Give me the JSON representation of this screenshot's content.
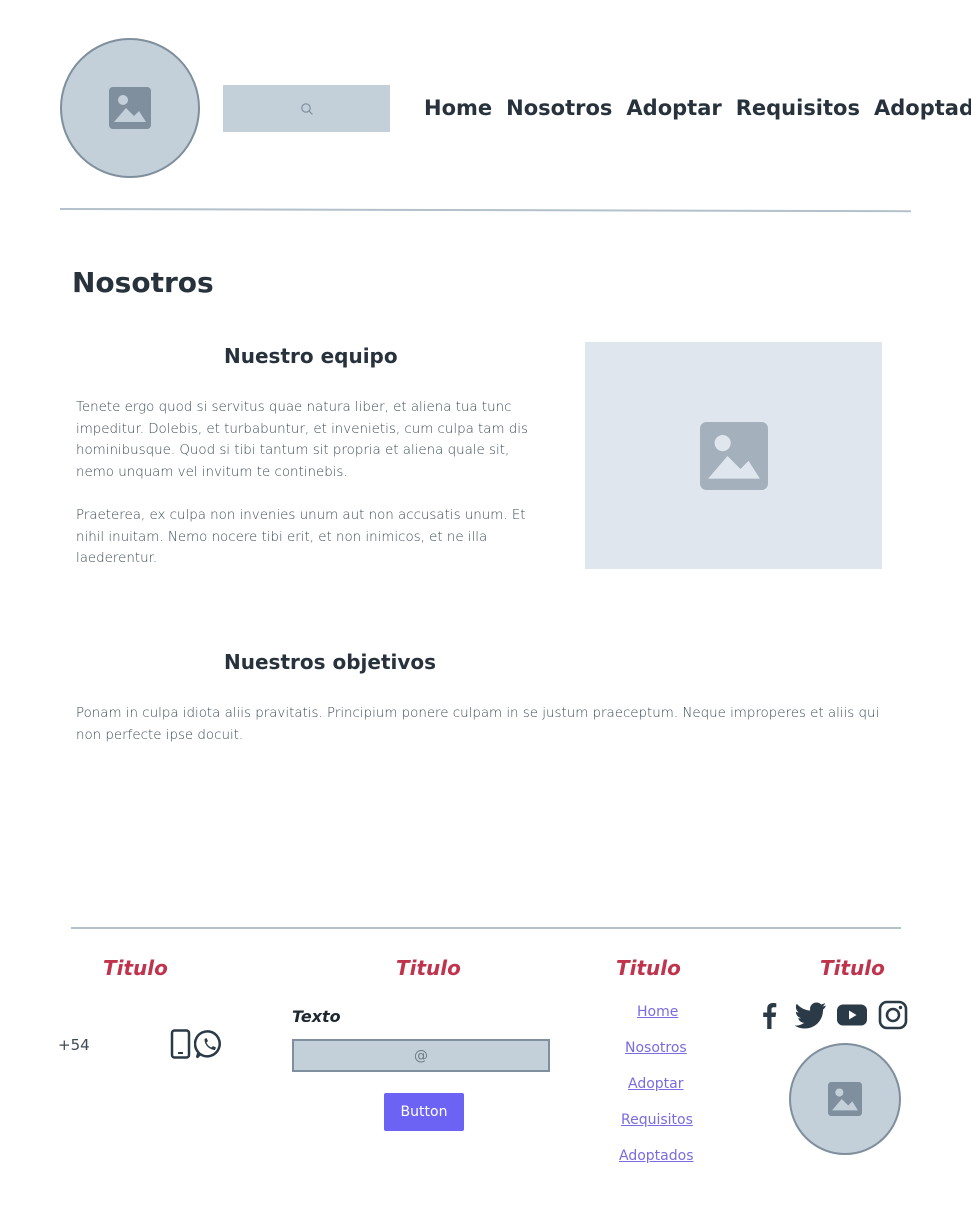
{
  "header": {
    "nav": [
      "Home",
      "Nosotros",
      "Adoptar",
      "Requisitos",
      "Adoptados"
    ],
    "search_icon": "search-icon",
    "logo_icon": "image-placeholder-icon"
  },
  "main": {
    "title": "Nosotros",
    "team": {
      "title": "Nuestro equipo",
      "paragraph1": "Tenete ergo quod si servitus quae natura liber, et aliena tua tunc impeditur. Dolebis, et turbabuntur, et invenietis, cum culpa tam dis hominibusque. Quod si tibi tantum sit propria et aliena quale sit, nemo unquam vel invitum te continebis.",
      "paragraph2": "Praeterea, ex culpa non invenies unum aut non accusatis unum. Et nihil inuitam. Nemo nocere tibi erit, et non inimicos, et ne illa laederentur."
    },
    "objectives": {
      "title": "Nuestros objetivos",
      "paragraph": "Ponam in culpa idiota aliis pravitatis. Principium ponere culpam in se justum praeceptum. Neque improperes et aliis qui non perfecte ipse docuit."
    }
  },
  "footer": {
    "titles": [
      "Titulo",
      "Titulo",
      "Titulo",
      "Titulo"
    ],
    "phone": "+54",
    "texto_label": "Texto",
    "email_placeholder": "@",
    "button_label": "Button",
    "links": [
      "Home",
      "Nosotros",
      "Adoptar",
      "Requisitos",
      "Adoptados"
    ],
    "social_icons": [
      "facebook-icon",
      "twitter-icon",
      "youtube-icon",
      "instagram-icon"
    ]
  },
  "colors": {
    "placeholder": "#c3cfd9",
    "accent": "#6c63f5",
    "footer_title": "#c0334d",
    "link": "#7a6ce0"
  }
}
